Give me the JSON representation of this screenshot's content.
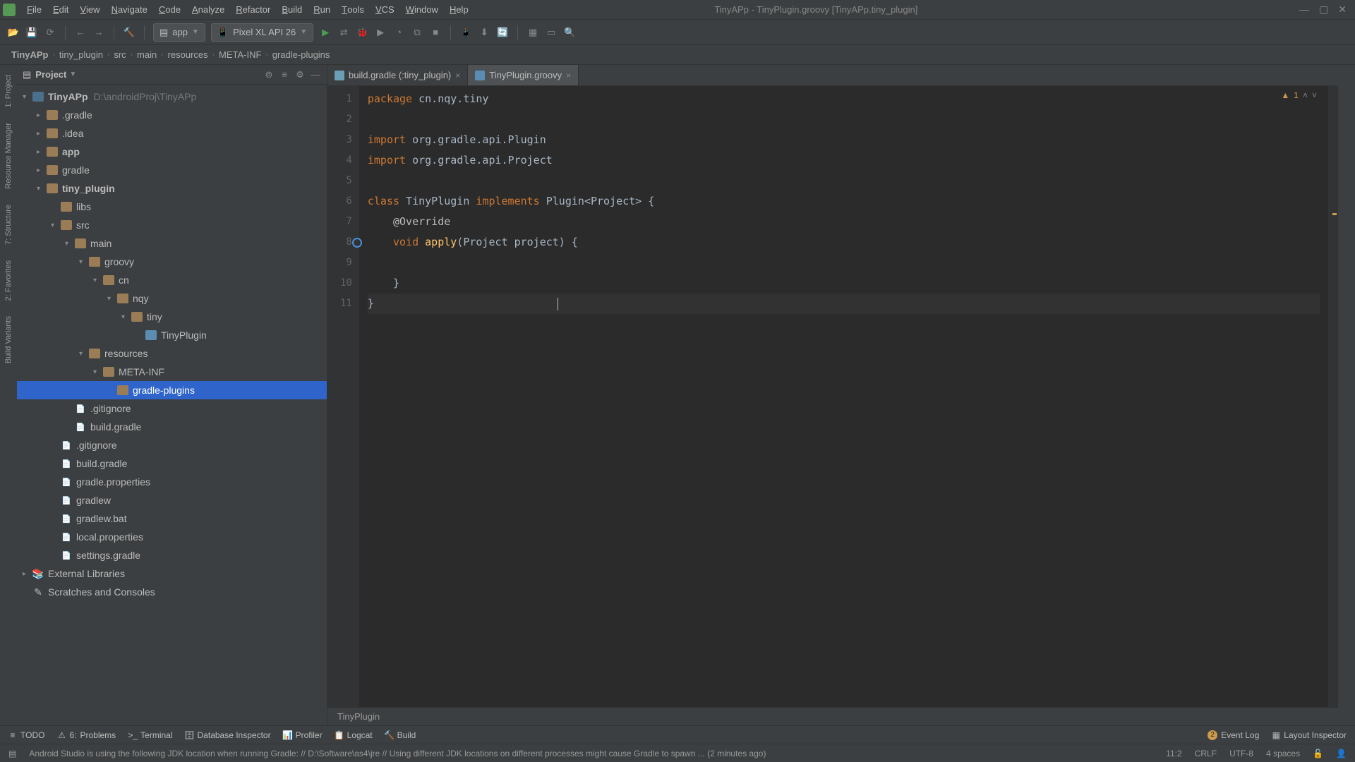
{
  "window": {
    "title": "TinyAPp - TinyPlugin.groovy [TinyAPp.tiny_plugin]"
  },
  "menu": [
    "File",
    "Edit",
    "View",
    "Navigate",
    "Code",
    "Analyze",
    "Refactor",
    "Build",
    "Run",
    "Tools",
    "VCS",
    "Window",
    "Help"
  ],
  "runConfig": {
    "module": "app",
    "device": "Pixel XL API 26"
  },
  "breadcrumb": [
    "TinyAPp",
    "tiny_plugin",
    "src",
    "main",
    "resources",
    "META-INF",
    "gradle-plugins"
  ],
  "projectPanel": {
    "title": "Project"
  },
  "tree": [
    {
      "ind": 8,
      "arrow": "▾",
      "ico": "module",
      "lbl": "TinyAPp",
      "lbl2": "D:\\androidProj\\TinyAPp",
      "bold": true
    },
    {
      "ind": 28,
      "arrow": "▸",
      "ico": "folder",
      "lbl": ".gradle"
    },
    {
      "ind": 28,
      "arrow": "▸",
      "ico": "folder",
      "lbl": ".idea"
    },
    {
      "ind": 28,
      "arrow": "▸",
      "ico": "folder",
      "lbl": "app",
      "bold": true
    },
    {
      "ind": 28,
      "arrow": "▸",
      "ico": "folder",
      "lbl": "gradle"
    },
    {
      "ind": 28,
      "arrow": "▾",
      "ico": "folder",
      "lbl": "tiny_plugin",
      "bold": true
    },
    {
      "ind": 48,
      "arrow": "",
      "ico": "folder",
      "lbl": "libs"
    },
    {
      "ind": 48,
      "arrow": "▾",
      "ico": "folder",
      "lbl": "src"
    },
    {
      "ind": 68,
      "arrow": "▾",
      "ico": "folder",
      "lbl": "main"
    },
    {
      "ind": 88,
      "arrow": "▾",
      "ico": "folder",
      "lbl": "groovy"
    },
    {
      "ind": 108,
      "arrow": "▾",
      "ico": "folder",
      "lbl": "cn"
    },
    {
      "ind": 128,
      "arrow": "▾",
      "ico": "folder",
      "lbl": "nqy"
    },
    {
      "ind": 148,
      "arrow": "▾",
      "ico": "folder",
      "lbl": "tiny"
    },
    {
      "ind": 168,
      "arrow": "",
      "ico": "groovy",
      "lbl": "TinyPlugin"
    },
    {
      "ind": 88,
      "arrow": "▾",
      "ico": "folder",
      "lbl": "resources"
    },
    {
      "ind": 108,
      "arrow": "▾",
      "ico": "folder",
      "lbl": "META-INF"
    },
    {
      "ind": 128,
      "arrow": "",
      "ico": "folder",
      "lbl": "gradle-plugins",
      "sel": true
    },
    {
      "ind": 68,
      "arrow": "",
      "ico": "file",
      "lbl": ".gitignore"
    },
    {
      "ind": 68,
      "arrow": "",
      "ico": "file",
      "lbl": "build.gradle"
    },
    {
      "ind": 48,
      "arrow": "",
      "ico": "file",
      "lbl": ".gitignore"
    },
    {
      "ind": 48,
      "arrow": "",
      "ico": "file",
      "lbl": "build.gradle"
    },
    {
      "ind": 48,
      "arrow": "",
      "ico": "file",
      "lbl": "gradle.properties"
    },
    {
      "ind": 48,
      "arrow": "",
      "ico": "file",
      "lbl": "gradlew"
    },
    {
      "ind": 48,
      "arrow": "",
      "ico": "file",
      "lbl": "gradlew.bat"
    },
    {
      "ind": 48,
      "arrow": "",
      "ico": "file",
      "lbl": "local.properties"
    },
    {
      "ind": 48,
      "arrow": "",
      "ico": "file",
      "lbl": "settings.gradle"
    },
    {
      "ind": 8,
      "arrow": "▸",
      "ico": "lib",
      "lbl": "External Libraries"
    },
    {
      "ind": 8,
      "arrow": "",
      "ico": "scratch",
      "lbl": "Scratches and Consoles"
    }
  ],
  "tabs": [
    {
      "label": "build.gradle (:tiny_plugin)",
      "ico": "gradle"
    },
    {
      "label": "TinyPlugin.groovy",
      "ico": "groovy",
      "active": true
    }
  ],
  "warnCount": "1",
  "code": {
    "lines": [
      {
        "n": 1,
        "html": "<span class='k1'>package</span> <span class='txt'>cn.nqy.tiny</span>"
      },
      {
        "n": 2,
        "html": ""
      },
      {
        "n": 3,
        "html": "<span class='k1'>import</span> <span class='txt'>org.gradle.api.Plugin</span>"
      },
      {
        "n": 4,
        "html": "<span class='k1'>import</span> <span class='txt'>org.gradle.api.Project</span>"
      },
      {
        "n": 5,
        "html": ""
      },
      {
        "n": 6,
        "html": "<span class='k1'>class</span> <span class='cls'>TinyPlugin</span> <span class='k1'>implements</span> <span class='txt'>Plugin&lt;Project&gt;</span> <span class='txt'>{</span>"
      },
      {
        "n": 7,
        "html": "    <span class='ann'>@Override</span>"
      },
      {
        "n": 8,
        "html": "    <span class='k2'>void</span> <span class='fn'>apply</span><span class='txt'>(Project project) {</span>",
        "omark": true
      },
      {
        "n": 9,
        "html": ""
      },
      {
        "n": 10,
        "html": "    <span class='txt'>}</span>"
      },
      {
        "n": 11,
        "html": "<span class='txt'>}</span>",
        "cursor": true
      }
    ]
  },
  "editorCrumb": "TinyPlugin",
  "bottomToolbar": {
    "left": [
      "TODO",
      "Problems",
      "Terminal",
      "Database Inspector",
      "Profiler",
      "Logcat",
      "Build"
    ],
    "leftBadge": "6:",
    "right": [
      "Event Log",
      "Layout Inspector"
    ],
    "rightBadge": "2"
  },
  "status": {
    "msg": "Android Studio is using the following JDK location when running Gradle: // D:\\Software\\as4\\jre // Using different JDK locations on different processes might cause Gradle to spawn ... (2 minutes ago)",
    "pos": "11:2",
    "lf": "CRLF",
    "enc": "UTF-8",
    "indent": "4 spaces"
  },
  "leftRailTabs": [
    "1: Project",
    "Resource Manager",
    "7: Structure",
    "2: Favorites",
    "Build Variants"
  ]
}
